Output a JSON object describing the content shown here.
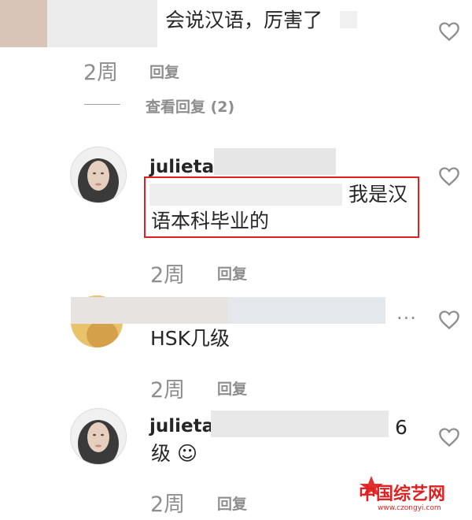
{
  "comments": {
    "c1": {
      "text": "会说汉语，厉害了",
      "time": "2周",
      "reply": "回复",
      "view_replies": "查看回复 (2)"
    },
    "c2": {
      "username": "julietal",
      "text_line1": "我是汉",
      "text_line2": "语本科毕业的",
      "time": "2周",
      "reply": "回复"
    },
    "c3": {
      "text": "HSK几级",
      "time": "2周",
      "reply": "回复",
      "more": "···"
    },
    "c4": {
      "username": "julieta",
      "text_end": "6",
      "text_line2": "级 ☺",
      "time": "2周",
      "reply": "回复"
    }
  },
  "watermark": {
    "brand": "中国综艺网",
    "url": "www.czongyi.com"
  },
  "colors": {
    "highlight": "#e02020",
    "muted": "#8e8e8e",
    "text": "#262626"
  }
}
